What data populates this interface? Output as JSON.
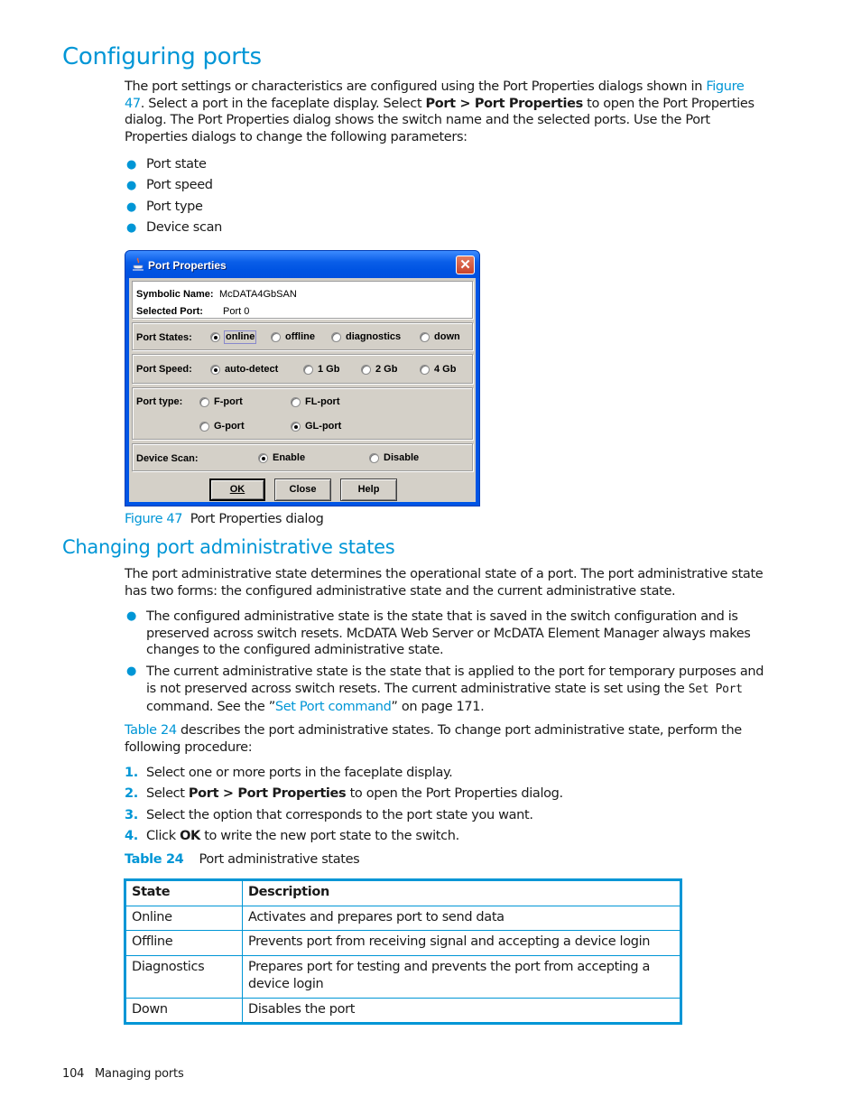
{
  "section1": {
    "heading": "Configuring ports",
    "intro": {
      "part1": "The port settings or characteristics are configured using the Port Properties dialogs shown in ",
      "link": "Figure 47",
      "part2": ". Select a port in the faceplate display. Select ",
      "bold": "Port > Port Properties",
      "part3": " to open the Port Properties dialog. The Port Properties dialog shows the switch name and the selected ports. Use the Port Properties dialogs to change the following parameters:"
    },
    "bullets": [
      "Port state",
      "Port speed",
      "Port type",
      "Device scan"
    ]
  },
  "dialog": {
    "title": "Port Properties",
    "close_icon": "close-icon",
    "symbolic_name_label": "Symbolic Name:",
    "symbolic_name_value": "McDATA4GbSAN",
    "selected_port_label": "Selected Port:",
    "selected_port_value": "Port 0",
    "port_states": {
      "label": "Port States:",
      "options": [
        "online",
        "offline",
        "diagnostics",
        "down"
      ],
      "selected": "online"
    },
    "port_speed": {
      "label": "Port Speed:",
      "options": [
        "auto-detect",
        "1 Gb",
        "2 Gb",
        "4 Gb"
      ],
      "selected": "auto-detect"
    },
    "port_type": {
      "label": "Port type:",
      "options": [
        "F-port",
        "FL-port",
        "G-port",
        "GL-port"
      ],
      "selected": "GL-port"
    },
    "device_scan": {
      "label": "Device Scan:",
      "options": [
        "Enable",
        "Disable"
      ],
      "selected": "Enable"
    },
    "buttons": {
      "ok": "OK",
      "close": "Close",
      "help": "Help"
    }
  },
  "figure_caption": {
    "label": "Figure 47",
    "text": "Port Properties dialog"
  },
  "section2": {
    "heading": "Changing port administrative states",
    "intro": "The port administrative state determines the operational state of a port. The port administrative state has two forms: the configured administrative state and the current administrative state.",
    "bullet1": "The configured administrative state is the state that is saved in the switch configuration and is preserved across switch resets. McDATA Web Server or McDATA Element Manager always makes changes to the configured administrative state.",
    "bullet2": {
      "part1": "The current administrative state is the state that is applied to the port for temporary purposes and is not preserved across switch resets. The current administrative state is set using the ",
      "code": "Set Port",
      "part2": " command. See the ”",
      "link": "Set Port command",
      "part3": "” on page 171."
    },
    "table_ref": {
      "link": "Table 24",
      "text": " describes the port administrative states. To change port administrative state, perform the following procedure:"
    },
    "steps": [
      {
        "num": "1.",
        "pre": "Select one or more ports in the faceplate display.",
        "bold": "",
        "post": ""
      },
      {
        "num": "2.",
        "pre": "Select ",
        "bold": "Port > Port Properties",
        "post": " to open the Port Properties dialog."
      },
      {
        "num": "3.",
        "pre": "Select the option that corresponds to the port state you want.",
        "bold": "",
        "post": ""
      },
      {
        "num": "4.",
        "pre": "Click ",
        "bold": "OK",
        "post": " to write the new port state to the switch."
      }
    ]
  },
  "table": {
    "caption_label": "Table 24",
    "caption_text": "Port administrative states",
    "headers": [
      "State",
      "Description"
    ],
    "rows": [
      [
        "Online",
        "Activates and prepares port to send data"
      ],
      [
        "Offline",
        "Prevents port from receiving signal and accepting a device login"
      ],
      [
        "Diagnostics",
        "Prepares port for testing and prevents the port from accepting a device login"
      ],
      [
        "Down",
        "Disables the port"
      ]
    ]
  },
  "footer": {
    "page_number": "104",
    "section": "Managing ports"
  },
  "colors": {
    "accent": "#0096d6",
    "dialog_title": "#0054e3",
    "dialog_body": "#d4d0c8"
  }
}
